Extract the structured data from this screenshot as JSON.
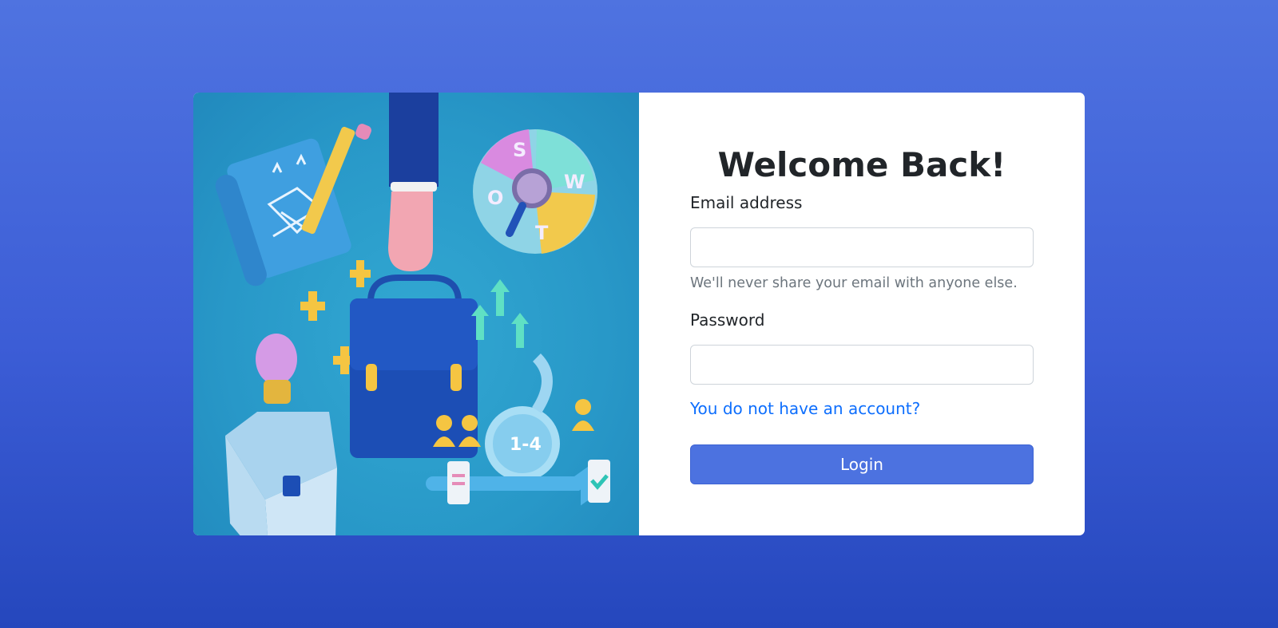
{
  "colors": {
    "page_bg_top": "#4f73e0",
    "page_bg_bottom": "#2547bd",
    "illustration_bg": "#2898c8",
    "button_bg": "#4c72e0",
    "link_color": "#0d6efd"
  },
  "login": {
    "title": "Welcome Back!",
    "email_label": "Email address",
    "email_value": "",
    "email_help": "We'll never share your email with anyone else.",
    "password_label": "Password",
    "password_value": "",
    "register_link": "You do not have an account?",
    "login_button": "Login"
  },
  "illustration": {
    "alt": "business-illustration",
    "swot_letters": [
      "S",
      "W",
      "O",
      "T"
    ],
    "loop_label": "1-4"
  }
}
